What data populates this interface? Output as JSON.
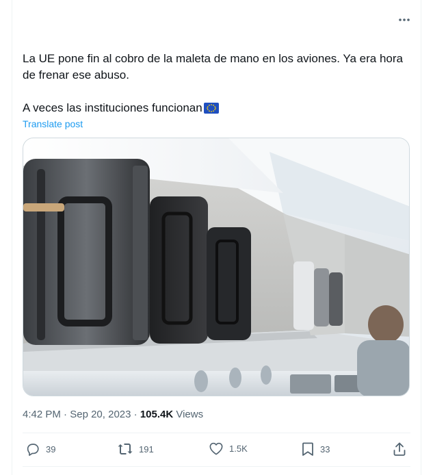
{
  "post": {
    "text_line1": "La UE pone fin al cobro de la maleta de mano en los aviones. Ya era hora de frenar ese abuso.",
    "text_line2": "A veces las instituciones funcionan",
    "translate_label": "Translate post",
    "time": "4:42 PM",
    "date": "Sep 20, 2023",
    "views_count": "105.4K",
    "views_label": "Views"
  },
  "actions": {
    "replies": "39",
    "reposts": "191",
    "likes": "1.5K",
    "bookmarks": "33"
  },
  "icons": [
    "more-icon",
    "eu-flag-icon",
    "reply-icon",
    "repost-icon",
    "like-icon",
    "bookmark-icon",
    "share-icon"
  ],
  "colors": {
    "link": "#1d9bf0",
    "muted": "#536471",
    "text": "#0f1419"
  }
}
